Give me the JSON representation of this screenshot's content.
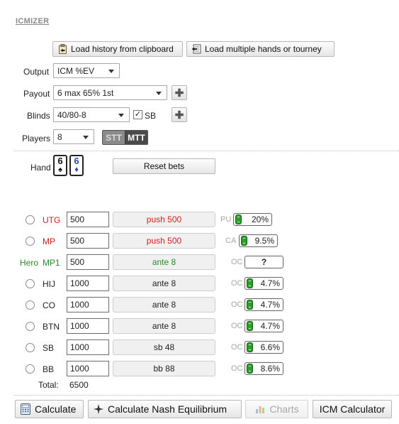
{
  "app": {
    "logo": "ICMIZER"
  },
  "toolbar": {
    "load_history_label": "Load history from clipboard",
    "load_multiple_label": "Load multiple hands or tourney"
  },
  "settings": {
    "output_label": "Output",
    "output_value": "ICM %EV",
    "payout_label": "Payout",
    "payout_value": "6 max 65% 1st",
    "blinds_label": "Blinds",
    "blinds_value": "40/80-8",
    "sb_label": "SB",
    "sb_checked": true,
    "players_label": "Players",
    "players_value": "8",
    "stt_label": "STT",
    "mtt_label": "MTT"
  },
  "hand": {
    "label": "Hand",
    "cards": [
      {
        "rank": "6",
        "suit": "♠",
        "color": "#111111"
      },
      {
        "rank": "6",
        "suit": "♦",
        "color": "#2b4fa8"
      }
    ],
    "reset_label": "Reset bets"
  },
  "players": [
    {
      "hero": "",
      "pos": "UTG",
      "stack": "500",
      "action": "push 500",
      "range_label": "PU",
      "range": "20%",
      "pos_color": "#d42020",
      "action_color": "#d42020",
      "radio": true
    },
    {
      "hero": "",
      "pos": "MP",
      "stack": "500",
      "action": "push 500",
      "range_label": "CA",
      "range": "9.5%",
      "pos_color": "#d42020",
      "action_color": "#d42020",
      "radio": true
    },
    {
      "hero": "Hero",
      "pos": "MP1",
      "stack": "500",
      "action": "ante 8",
      "range_label": "OC",
      "range": "?",
      "pos_color": "#2a8a2a",
      "action_color": "#2a8a2a",
      "radio": false
    },
    {
      "hero": "",
      "pos": "HIJ",
      "stack": "1000",
      "action": "ante 8",
      "range_label": "OC",
      "range": "4.7%",
      "pos_color": "#222222",
      "action_color": "#222222",
      "radio": true
    },
    {
      "hero": "",
      "pos": "CO",
      "stack": "1000",
      "action": "ante 8",
      "range_label": "OC",
      "range": "4.7%",
      "pos_color": "#222222",
      "action_color": "#222222",
      "radio": true
    },
    {
      "hero": "",
      "pos": "BTN",
      "stack": "1000",
      "action": "ante 8",
      "range_label": "OC",
      "range": "4.7%",
      "pos_color": "#222222",
      "action_color": "#222222",
      "radio": true
    },
    {
      "hero": "",
      "pos": "SB",
      "stack": "1000",
      "action": "sb 48",
      "range_label": "OC",
      "range": "6.6%",
      "pos_color": "#222222",
      "action_color": "#222222",
      "radio": true
    },
    {
      "hero": "",
      "pos": "BB",
      "stack": "1000",
      "action": "bb 88",
      "range_label": "OC",
      "range": "8.6%",
      "pos_color": "#222222",
      "action_color": "#222222",
      "radio": true
    }
  ],
  "total": {
    "label": "Total:",
    "value": "6500"
  },
  "actions": {
    "calculate_label": "Calculate",
    "nash_label": "Calculate Nash Equilibrium",
    "charts_label": "Charts",
    "icm_calc_label": "ICM Calculator"
  }
}
